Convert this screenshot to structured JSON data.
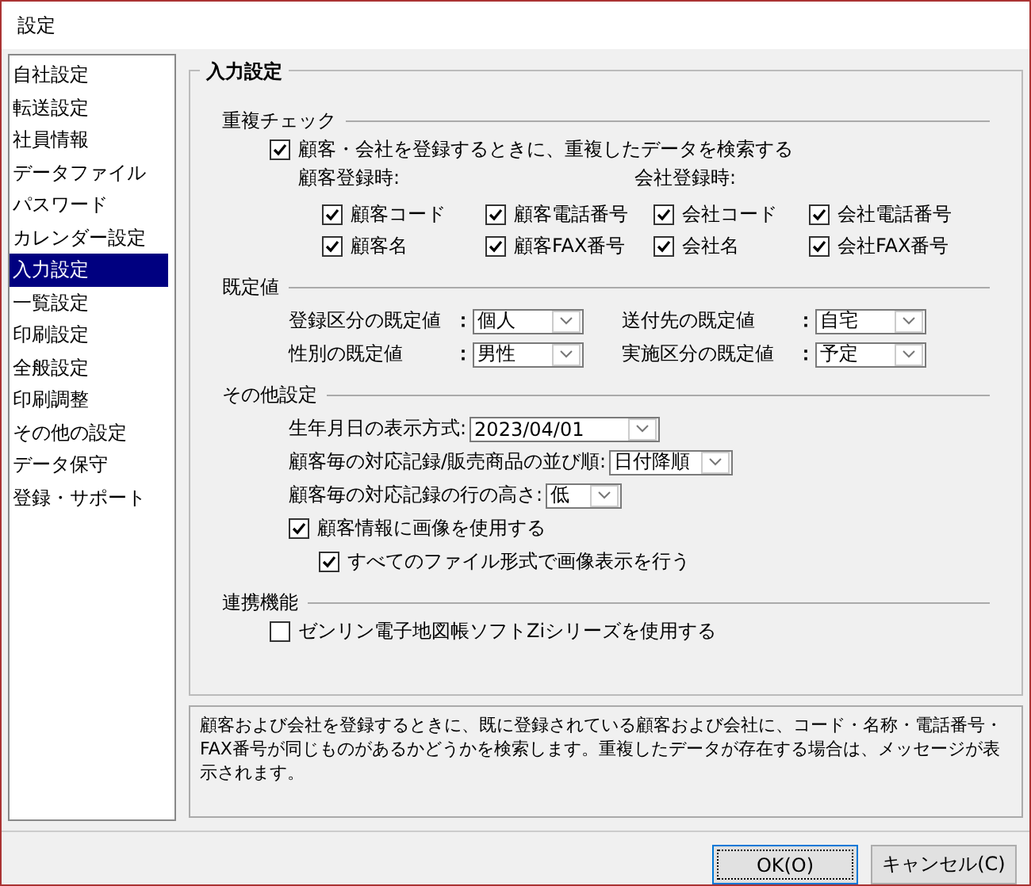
{
  "window": {
    "title": "設定"
  },
  "sidebar": {
    "items": [
      {
        "label": "自社設定",
        "selected": false
      },
      {
        "label": "転送設定",
        "selected": false
      },
      {
        "label": "社員情報",
        "selected": false
      },
      {
        "label": "データファイル",
        "selected": false
      },
      {
        "label": "パスワード",
        "selected": false
      },
      {
        "label": "カレンダー設定",
        "selected": false
      },
      {
        "label": "入力設定",
        "selected": true
      },
      {
        "label": "一覧設定",
        "selected": false
      },
      {
        "label": "印刷設定",
        "selected": false
      },
      {
        "label": "全般設定",
        "selected": false
      },
      {
        "label": "印刷調整",
        "selected": false
      },
      {
        "label": "その他の設定",
        "selected": false
      },
      {
        "label": "データ保守",
        "selected": false
      },
      {
        "label": "登録・サポート",
        "selected": false
      }
    ]
  },
  "panel": {
    "title": "入力設定",
    "duplicate_check": {
      "title": "重複チェック",
      "main_checkbox": {
        "label": "顧客・会社を登録するときに、重複したデータを検索する",
        "checked": true
      },
      "customer_heading": "顧客登録時:",
      "company_heading": "会社登録時:",
      "checkboxes": [
        {
          "label": "顧客コード",
          "checked": true
        },
        {
          "label": "顧客電話番号",
          "checked": true
        },
        {
          "label": "会社コード",
          "checked": true
        },
        {
          "label": "会社電話番号",
          "checked": true
        },
        {
          "label": "顧客名",
          "checked": true
        },
        {
          "label": "顧客FAX番号",
          "checked": true
        },
        {
          "label": "会社名",
          "checked": true
        },
        {
          "label": "会社FAX番号",
          "checked": true
        }
      ]
    },
    "defaults": {
      "title": "既定値",
      "fields": [
        {
          "label": "登録区分の既定値",
          "colon": "：",
          "value": "個人"
        },
        {
          "label": "送付先の既定値",
          "colon": "：",
          "value": "自宅"
        },
        {
          "label": "性別の既定値",
          "colon": "：",
          "value": "男性"
        },
        {
          "label": "実施区分の既定値",
          "colon": "：",
          "value": "予定"
        }
      ]
    },
    "other": {
      "title": "その他設定",
      "items": [
        {
          "kind": "dropdown",
          "label": "生年月日の表示方式:",
          "value": "2023/04/01"
        },
        {
          "kind": "dropdown",
          "label": "顧客毎の対応記録/販売商品の並び順:",
          "value": "日付降順"
        },
        {
          "kind": "dropdown",
          "label": "顧客毎の対応記録の行の高さ:",
          "value": "低"
        },
        {
          "kind": "checkbox",
          "label": "顧客情報に画像を使用する",
          "checked": true,
          "children": [
            {
              "kind": "checkbox",
              "label": "すべてのファイル形式で画像表示を行う",
              "checked": true
            }
          ]
        }
      ]
    },
    "linkage": {
      "title": "連携機能",
      "checkbox": {
        "label": "ゼンリン電子地図帳ソフトZiシリーズを使用する",
        "checked": false
      }
    }
  },
  "description": "顧客および会社を登録するときに、既に登録されている顧客および会社に、コード・名称・電話番号・FAX番号が同じものがあるかどうかを検索します。重複したデータが存在する場合は、メッセージが表示されます。",
  "buttons": [
    {
      "label": "OK(O)",
      "default": true
    },
    {
      "label": "キャンセル(C)",
      "default": false
    }
  ]
}
